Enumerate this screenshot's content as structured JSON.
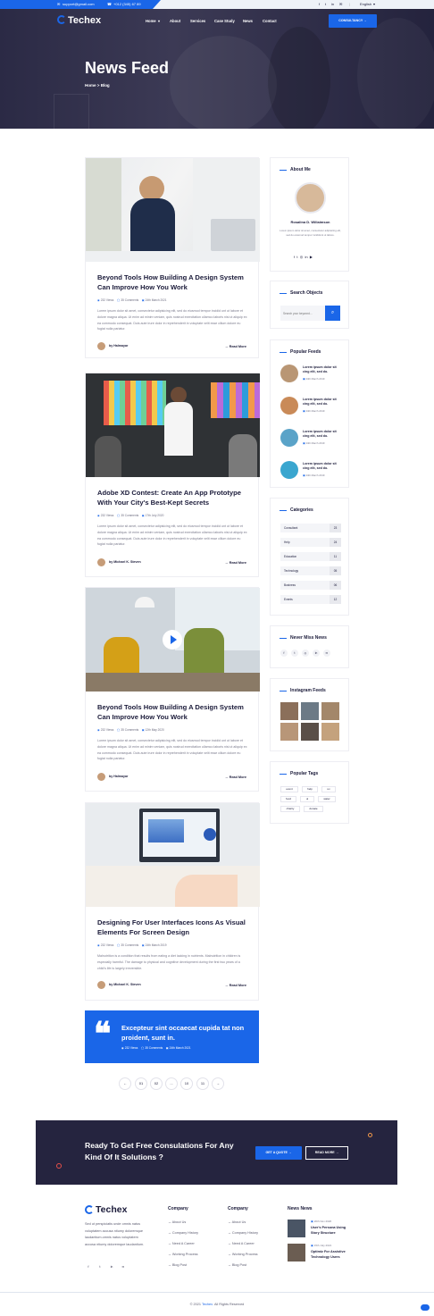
{
  "topbar": {
    "email": "support@gmail.com",
    "phone": "+012 (345) 67 89",
    "social": [
      "f",
      "t",
      "in",
      "✉"
    ],
    "language": "English"
  },
  "nav": {
    "logo": "Techex",
    "items": [
      "Home",
      "About",
      "Services",
      "Case Study",
      "News",
      "Contact"
    ],
    "cta": "CONSULTANCY"
  },
  "hero": {
    "title": "News Feed",
    "breadcrumb_home": "Home",
    "breadcrumb_sep": ">",
    "breadcrumb_current": "Blog"
  },
  "posts": [
    {
      "title": "Beyond Tools How Building A Design System Can Improve How You Work",
      "views": "232 Views",
      "comments": "35 Comments",
      "date": "24th March 2021",
      "excerpt": "Lorem ipsum dolor sit amet, consectetur adipisicing elit, sed do eiusmod tempor incidid unt ut labore et dolore magna aliqua. Ut enim ad minim veniam, quis nostrud exercitation ullamco laboris nisi ut aliquip ex ea commodo consequat. Duis aute irure dolor in reprehenderit in voluptate velit esse cillum dolore eu fugiat nulla pariatur.",
      "author": "by Halmayar",
      "read_more": "Read More"
    },
    {
      "title": "Adobe XD Contest: Create An App Prototype With Your City's Best-Kept Secrets",
      "views": "232 Views",
      "comments": "35 Comments",
      "date": "17th July 2020",
      "excerpt": "Lorem ipsum dolor sit amet, consectetur adipisicing elit, sed do eiusmod tempor incidid unt ut labore et dolore magna aliqua. Ut enim ad minim veniam, quis nostrud exercitation ullamco laboris nisi ut aliquip ex ea commodo consequat. Duis aute irure dolor in reprehenderit in voluptate velit esse cillum dolore eu fugiat nulla pariatur.",
      "author": "by Michael K. Steven",
      "read_more": "Read More"
    },
    {
      "title": "Beyond Tools How Building A Design System Can Improve How You Work",
      "views": "232 Views",
      "comments": "35 Comments",
      "date": "12th May 2020",
      "excerpt": "Lorem ipsum dolor sit amet, consectetur adipisicing elit, sed do eiusmod tempor incidid unt ut labore et dolore magna aliqua. Ut enim ad minim veniam, quis nostrud exercitation ullamco laboris nisi ut aliquip ex ea commodo consequat. Duis aute irure dolor in reprehenderit in voluptate velit esse cillum dolore eu fugiat nulla pariatur.",
      "author": "by Halmayar",
      "read_more": "Read More"
    },
    {
      "title": "Designing For User Interfaces Icons As Visual Elements For Screen Design",
      "views": "232 Views",
      "comments": "35 Comments",
      "date": "24th March 2019",
      "excerpt": "Malnutrition is a condition that results from eating a diet lacking in nutrients. Malnutrition in children is especially harmful. The damage to physical and cognitive development during the first two years of a child's life is largely irreversible.",
      "author": "by Michael K. Steven",
      "read_more": "Read More"
    }
  ],
  "quote": {
    "text": "Excepteur sint occaecat cupida tat non proident, sunt in.",
    "views": "232 Views",
    "comments": "35 Comments",
    "date": "24th March 2021"
  },
  "pagination": [
    "←",
    "01",
    "02",
    "...",
    "10",
    "11",
    "→"
  ],
  "sidebar": {
    "about": {
      "title": "About Me",
      "name": "Rosalina D. Willaimson",
      "bio": "Lorem ipsum dolor sit amet, consectetur adipisicing elit, sed do eiusmod tempor incididunt ut labore.",
      "social": [
        "f",
        "t",
        "◎",
        "in",
        "▶"
      ]
    },
    "search": {
      "title": "Search Objects",
      "placeholder": "Search your keyword..."
    },
    "popular": {
      "title": "Popular Feeds",
      "items": [
        {
          "title": "Lorem ipsum dolor sit cing elit, sed do.",
          "date": "24th March 2019"
        },
        {
          "title": "Lorem ipsum dolor sit cing elit, sed do.",
          "date": "24th March 2019"
        },
        {
          "title": "Lorem ipsum dolor sit cing elit, sed do.",
          "date": "24th March 2019"
        },
        {
          "title": "Lorem ipsum dolor sit cing elit, sed do.",
          "date": "24th March 2019"
        }
      ]
    },
    "categories": {
      "title": "Categories",
      "items": [
        {
          "name": "Consultant",
          "count": "23"
        },
        {
          "name": "Help",
          "count": "24"
        },
        {
          "name": "Education",
          "count": "11"
        },
        {
          "name": "Technology",
          "count": "05"
        },
        {
          "name": "Business",
          "count": "06"
        },
        {
          "name": "Events",
          "count": "12"
        }
      ]
    },
    "newsletter": {
      "title": "Never Miss News",
      "social": [
        "f",
        "t",
        "◎",
        "in",
        "✉"
      ]
    },
    "instagram": {
      "title": "Instagram Feeds"
    },
    "tags": {
      "title": "Popular Tags",
      "items": [
        "event",
        "help",
        "ux",
        "food",
        "ui",
        "water",
        "charity",
        "donate"
      ]
    }
  },
  "cta": {
    "title": "Ready To Get Free Consulations For Any Kind Of It Solutions ?",
    "primary": "GET A QUOTE",
    "secondary": "READ MORE"
  },
  "footer": {
    "logo": "Techex",
    "about": "Sed ut perspiciatis unde omnis natus voluptatem accusa ntiumy doloremque laudantium.omnis natus voluptatem accusa ntiumy doloremque laudantium.",
    "social": [
      "f",
      "t",
      "in",
      "✉"
    ],
    "col1_title": "Company",
    "col1": [
      "About Us",
      "Company History",
      "Need A Career",
      "Working Process",
      "Blog Post"
    ],
    "col2_title": "Company",
    "col2": [
      "About Us",
      "Company History",
      "Need A Career",
      "Working Process",
      "Blog Post"
    ],
    "news_title": "News News",
    "news": [
      {
        "date": "20th Nov 2020",
        "title": "User's Persona Using Story Structure"
      },
      {
        "date": "15th July 2021",
        "title": "Optimiz For Assistive Technology Users"
      }
    ],
    "copyright_pre": "© 2021",
    "copyright_brand": "Techex.",
    "copyright_post": "All Rights Reserved"
  },
  "colors": {
    "accent": "#1a66e8",
    "dark": "#25243f"
  }
}
